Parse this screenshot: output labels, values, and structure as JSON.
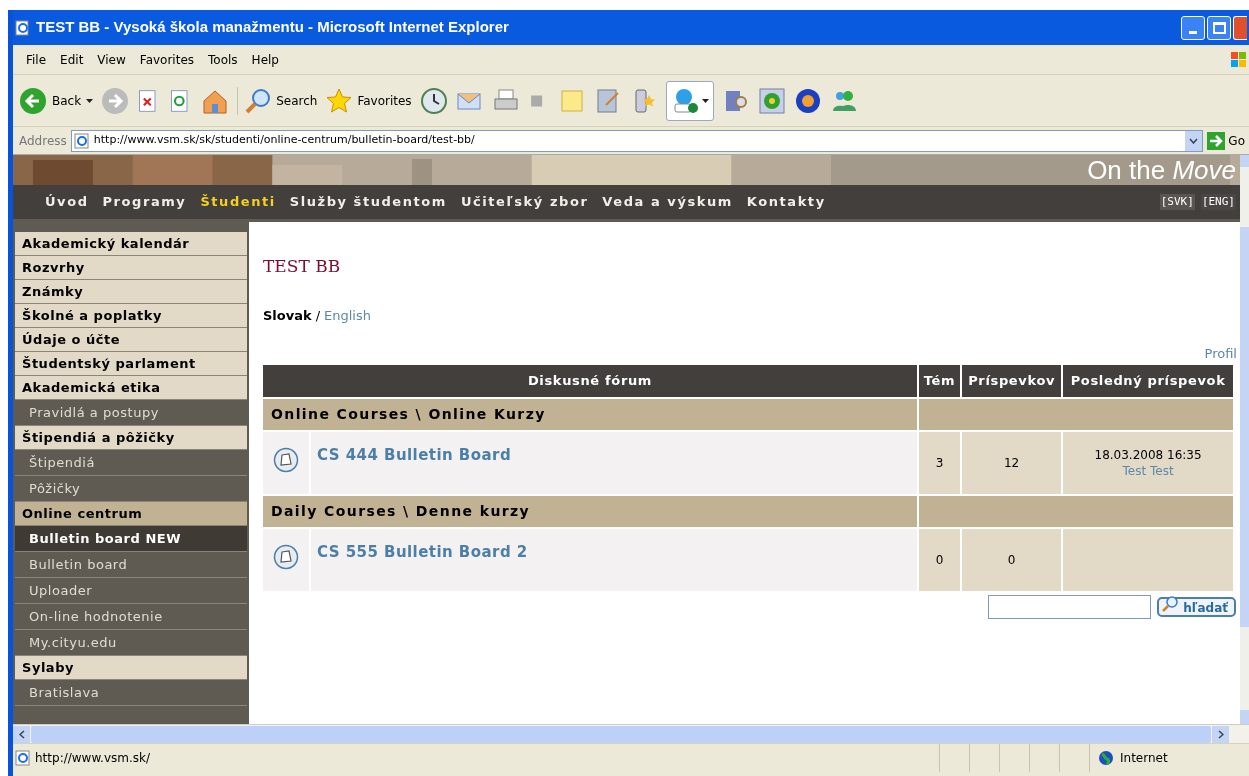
{
  "window": {
    "title": "TEST BB - Vysoká škola manažmentu - Microsoft Internet Explorer"
  },
  "menu": [
    "File",
    "Edit",
    "View",
    "Favorites",
    "Tools",
    "Help"
  ],
  "toolbar": {
    "back": "Back",
    "search": "Search",
    "favorites": "Favorites"
  },
  "address": {
    "label": "Address",
    "url": "http://www.vsm.sk/sk/studenti/online-centrum/bulletin-board/test-bb/",
    "go": "Go"
  },
  "banner": {
    "tagline": "On the ",
    "tagline_italic": "Move"
  },
  "nav": [
    {
      "label": "Úvod",
      "selected": false
    },
    {
      "label": "Programy",
      "selected": false
    },
    {
      "label": "Študenti",
      "selected": true
    },
    {
      "label": "Služby študentom",
      "selected": false
    },
    {
      "label": "Učiteľský zbor",
      "selected": false
    },
    {
      "label": "Veda a výskum",
      "selected": false
    },
    {
      "label": "Kontakty",
      "selected": false
    }
  ],
  "languages": [
    {
      "label": "[SVK]",
      "selected": true
    },
    {
      "label": "[ENG]",
      "selected": false
    }
  ],
  "sidebar": {
    "items": [
      {
        "label": "Akademický kalendár",
        "kind": "section",
        "selected": false
      },
      {
        "label": "Rozvrhy",
        "kind": "section",
        "selected": false
      },
      {
        "label": "Známky",
        "kind": "section",
        "selected": false
      },
      {
        "label": "Školné a poplatky",
        "kind": "section",
        "selected": false
      },
      {
        "label": "Údaje o účte",
        "kind": "section",
        "selected": false
      },
      {
        "label": "Študentský parlament",
        "kind": "section",
        "selected": false
      },
      {
        "label": "Akademická etika",
        "kind": "section",
        "selected": false
      },
      {
        "label": "Pravidlá a postupy",
        "kind": "sub",
        "selected": false
      },
      {
        "label": "Štipendiá a pôžičky",
        "kind": "section",
        "selected": false
      },
      {
        "label": "Štipendiá",
        "kind": "sub",
        "selected": false
      },
      {
        "label": "Pôžičky",
        "kind": "sub",
        "selected": false
      },
      {
        "label": "Online centrum",
        "kind": "section",
        "selected": true
      },
      {
        "label": "Bulletin board NEW",
        "kind": "sub",
        "selected": true
      },
      {
        "label": "Bulletin board",
        "kind": "sub",
        "selected": false
      },
      {
        "label": "Uploader",
        "kind": "sub",
        "selected": false
      },
      {
        "label": "On-line hodnotenie",
        "kind": "sub",
        "selected": false
      },
      {
        "label": "My.cityu.edu",
        "kind": "sub",
        "selected": false
      },
      {
        "label": "Sylaby",
        "kind": "section",
        "selected": false
      },
      {
        "label": "Bratislava",
        "kind": "sub",
        "selected": false
      }
    ]
  },
  "page": {
    "title": "TEST BB",
    "language_current": "Slovak",
    "language_separator": "/",
    "language_other": "English",
    "profile_link": "Profil"
  },
  "table": {
    "columns": [
      "Diskusné fórum",
      "Tém",
      "Príspevkov",
      "Posledný príspevok"
    ],
    "groups": [
      {
        "name": "Online Courses \\ Online Kurzy",
        "forums": [
          {
            "title": "CS 444 Bulletin Board",
            "topics": "3",
            "posts": "12",
            "last_date": "18.03.2008 16:35",
            "last_author": "Test Test"
          }
        ]
      },
      {
        "name": "Daily Courses \\ Denne kurzy",
        "forums": [
          {
            "title": "CS 555 Bulletin Board 2",
            "topics": "0",
            "posts": "0"
          }
        ]
      }
    ]
  },
  "search": {
    "button": "hľadať"
  },
  "status_bar": {
    "url": "http://www.vsm.sk/",
    "zone": "Internet"
  }
}
